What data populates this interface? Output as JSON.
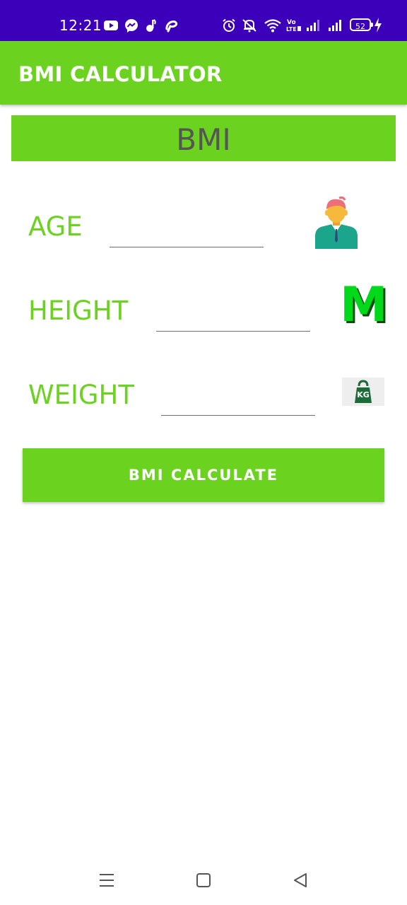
{
  "status_bar": {
    "time": "12:21",
    "battery": "52",
    "left_icons": [
      "youtube-icon",
      "messenger-icon",
      "music-icon",
      "airtel-icon"
    ],
    "right_icons": [
      "alarm-icon",
      "mute-icon",
      "wifi-icon",
      "volte-icon",
      "signal-icon",
      "signal-icon",
      "battery-icon",
      "charging-icon"
    ]
  },
  "app_bar": {
    "title": "BMI CALCULATOR"
  },
  "banner": {
    "text": "BMI"
  },
  "form": {
    "age_label": "AGE",
    "height_label": "HEIGHT",
    "weight_label": "WEIGHT",
    "age_value": "",
    "height_value": "",
    "weight_value": "",
    "height_icon_text": "M",
    "weight_icon_text": "KG"
  },
  "actions": {
    "calculate_label": "BMI CALCULATE"
  },
  "nav_bar": {
    "icons": [
      "menu-icon",
      "home-icon",
      "back-icon"
    ]
  },
  "colors": {
    "status_bar": "#3c00ba",
    "accent_green": "#6bd320",
    "banner_text": "#555555"
  }
}
